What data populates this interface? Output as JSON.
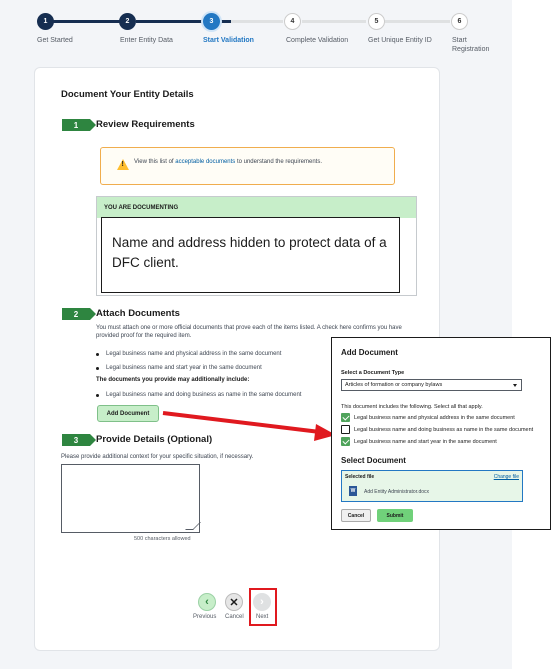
{
  "stepper": {
    "steps": [
      {
        "number": "1",
        "label": "Get Started",
        "state": "done"
      },
      {
        "number": "2",
        "label": "Enter Entity Data",
        "state": "done"
      },
      {
        "number": "3",
        "label": "Start Validation",
        "state": "current"
      },
      {
        "number": "4",
        "label": "Complete Validation",
        "state": "todo"
      },
      {
        "number": "5",
        "label": "Get Unique Entity ID",
        "state": "todo"
      },
      {
        "number": "6",
        "label": "Start Registration",
        "state": "todo"
      }
    ]
  },
  "page": {
    "title": "Document Your Entity Details"
  },
  "section1": {
    "number": "1",
    "title": "Review Requirements",
    "alert_prefix": "View this list of ",
    "alert_link": "acceptable documents",
    "alert_suffix": " to understand the requirements.",
    "documenting_header": "YOU ARE DOCUMENTING",
    "hidden_note": "Name and address hidden to protect data of a DFC client."
  },
  "section2": {
    "number": "2",
    "title": "Attach Documents",
    "description": "You must attach one or more official documents that prove each of the items listed. A check here confirms you have provided proof for the required item.",
    "required_items": [
      "Legal business name and physical address in the same document",
      "Legal business name and start year in the same document"
    ],
    "additional_heading": "The documents you provide may additionally include:",
    "additional_items": [
      "Legal business name and doing business as name in the same document"
    ],
    "add_button": "Add Document"
  },
  "section3": {
    "number": "3",
    "title": "Provide Details (Optional)",
    "description": "Please provide additional context for your specific situation, if necessary.",
    "textarea_value": "",
    "char_count": "500 characters allowed"
  },
  "nav": {
    "previous": "Previous",
    "cancel": "Cancel",
    "next": "Next",
    "previous_icon": "‹",
    "cancel_icon": "✕",
    "next_icon": "›"
  },
  "popup": {
    "title": "Add Document",
    "select_label": "Select a Document Type",
    "select_value": "Articles of formation or company bylaws",
    "includes_text": "This document includes the following. Select all that apply.",
    "checks": [
      {
        "label": "Legal business name and physical address in the same document",
        "checked": true
      },
      {
        "label": "Legal business name and doing business as name in the same document",
        "checked": false
      },
      {
        "label": "Legal business name and start year in the same document",
        "checked": true
      }
    ],
    "select_document_title": "Select Document",
    "selected_file_label": "Selected file",
    "change_file": "Change file",
    "file_icon_letter": "W",
    "file_name": "Add Entity Administrator.docx",
    "cancel": "Cancel",
    "submit": "Submit"
  },
  "colors": {
    "stepper_done": "#162e51",
    "stepper_current": "#2378c3",
    "green_accent": "#2e8540",
    "highlight_red": "#e0191f"
  }
}
